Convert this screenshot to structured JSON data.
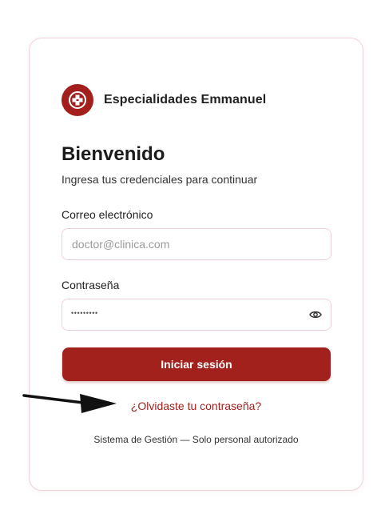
{
  "brand": {
    "name": "Especialidades Emmanuel",
    "logo_icon": "medical-cross-icon",
    "accent": "#a3211d"
  },
  "login": {
    "title": "Bienvenido",
    "subtitle": "Ingresa tus credenciales para continuar",
    "email_label": "Correo electrónico",
    "email_placeholder": "doctor@clinica.com",
    "password_label": "Contraseña",
    "password_mask": "•••••••••",
    "password_toggle_icon": "eye-icon",
    "submit_label": "Iniciar sesión",
    "forgot_link": "¿Olvidaste tu contraseña?",
    "footer": "Sistema de Gestión — Solo personal autorizado"
  },
  "annotation": {
    "icon": "arrow-right-icon",
    "color": "#111111"
  }
}
